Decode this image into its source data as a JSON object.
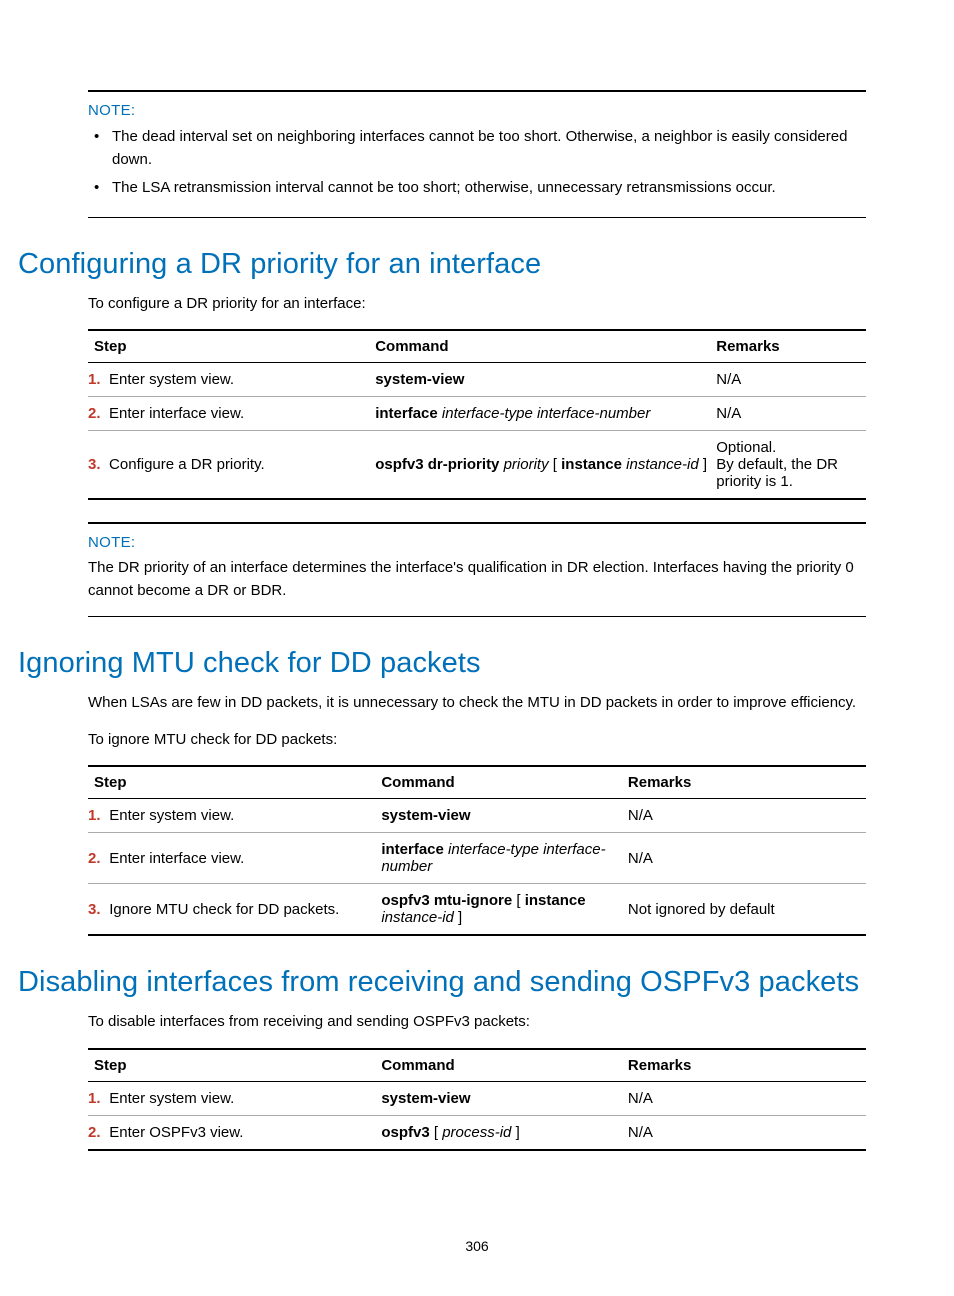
{
  "note1": {
    "label": "NOTE:",
    "items": [
      "The dead interval set on neighboring interfaces cannot be too short. Otherwise, a neighbor is easily considered down.",
      "The LSA retransmission interval cannot be too short; otherwise, unnecessary retransmissions occur."
    ]
  },
  "section1": {
    "heading": "Configuring a DR priority for an interface",
    "intro": "To configure a DR priority for an interface:",
    "table": {
      "headers": {
        "step": "Step",
        "command": "Command",
        "remarks": "Remarks"
      },
      "rows": [
        {
          "num": "1.",
          "step": "Enter system view.",
          "cmd_bold": "system-view",
          "cmd_italic": "",
          "remarks": "N/A"
        },
        {
          "num": "2.",
          "step": "Enter interface view.",
          "cmd_bold": "interface",
          "cmd_italic": " interface-type interface-number",
          "remarks": "N/A"
        },
        {
          "num": "3.",
          "step": "Configure a DR priority.",
          "cmd_html": "ospfv3 dr-priority <i>priority</i> [ <b>instance</b> <i>instance-id</i> ]",
          "remarks": "Optional.\nBy default, the DR priority is 1."
        }
      ]
    }
  },
  "note2": {
    "label": "NOTE:",
    "text": "The DR priority of an interface determines the interface's qualification in DR election. Interfaces having the priority 0 cannot become a DR or BDR."
  },
  "section2": {
    "heading": "Ignoring MTU check for DD packets",
    "body": "When LSAs are few in DD packets, it is unnecessary to check the MTU in DD packets in order to improve efficiency.",
    "intro": "To ignore MTU check for DD packets:",
    "table": {
      "headers": {
        "step": "Step",
        "command": "Command",
        "remarks": "Remarks"
      },
      "rows": [
        {
          "num": "1.",
          "step": "Enter system view.",
          "cmd_bold": "system-view",
          "cmd_italic": "",
          "remarks": "N/A"
        },
        {
          "num": "2.",
          "step": "Enter interface view.",
          "cmd_html": "<b>interface</b> <i>interface-type interface-number</i>",
          "remarks": "N/A"
        },
        {
          "num": "3.",
          "step": "Ignore MTU check for DD packets.",
          "cmd_html": "<b>ospfv3 mtu-ignore</b> [ <b>instance</b> <i>instance-id</i> ]",
          "remarks": "Not ignored by default"
        }
      ]
    }
  },
  "section3": {
    "heading": "Disabling interfaces from receiving and sending OSPFv3 packets",
    "intro": "To disable interfaces from receiving and sending OSPFv3 packets:",
    "table": {
      "headers": {
        "step": "Step",
        "command": "Command",
        "remarks": "Remarks"
      },
      "rows": [
        {
          "num": "1.",
          "step": "Enter system view.",
          "cmd_bold": "system-view",
          "cmd_italic": "",
          "remarks": "N/A"
        },
        {
          "num": "2.",
          "step": "Enter OSPFv3 view.",
          "cmd_html": "<b>ospfv3</b> [ <i>process-id</i> ]",
          "remarks": "N/A"
        }
      ]
    }
  },
  "page_number": "306"
}
